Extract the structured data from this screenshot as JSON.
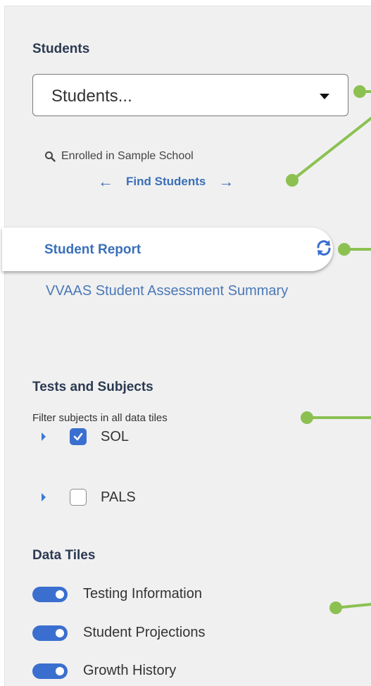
{
  "students": {
    "heading": "Students",
    "dropdown_value": "Students...",
    "enrolled_text": "Enrolled in Sample School",
    "find_label": "Find Students"
  },
  "report": {
    "title": "Student Report",
    "link": "VVAAS Student Assessment Summary"
  },
  "tests": {
    "heading": "Tests and Subjects",
    "filter_note": "Filter subjects in all data tiles",
    "subjects": [
      {
        "label": "SOL",
        "checked": true
      },
      {
        "label": "PALS",
        "checked": false
      }
    ]
  },
  "tiles": {
    "heading": "Data Tiles",
    "items": [
      {
        "label": "Testing Information",
        "on": true
      },
      {
        "label": "Student Projections",
        "on": true
      },
      {
        "label": "Growth History",
        "on": true
      }
    ]
  },
  "colors": {
    "accent": "#3a6fd0",
    "link": "#3a6fb8",
    "callout": "#8cc152"
  },
  "icons": [
    "search-icon",
    "arrow-left-icon",
    "arrow-right-icon",
    "refresh-icon",
    "dropdown-caret-icon",
    "expand-triangle-icon",
    "checkmark-icon"
  ]
}
